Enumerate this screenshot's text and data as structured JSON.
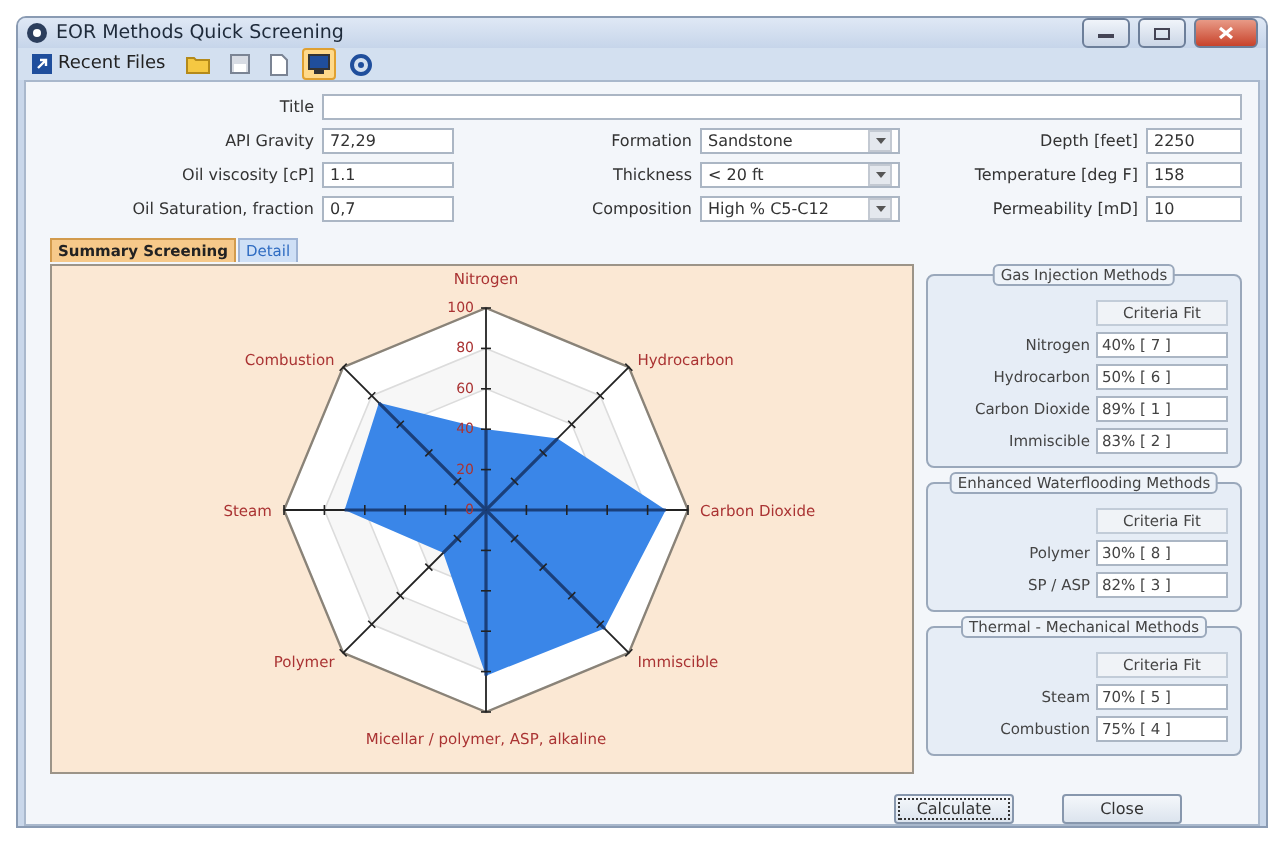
{
  "window": {
    "title": "EOR Methods Quick Screening"
  },
  "toolbar": [
    {
      "kind": "recent",
      "label": "Recent Files",
      "selected": false
    },
    {
      "kind": "folder",
      "selected": false
    },
    {
      "kind": "save",
      "selected": false
    },
    {
      "kind": "document",
      "selected": false
    },
    {
      "kind": "monitor",
      "selected": true
    },
    {
      "kind": "circle",
      "selected": false
    }
  ],
  "form": {
    "title_label": "Title",
    "rows": [
      [
        {
          "label": "API Gravity",
          "value": "72,29",
          "kind": "text"
        },
        {
          "label": "Formation",
          "value": "Sandstone",
          "kind": "select"
        },
        {
          "label": "Depth [feet]",
          "value": "2250",
          "kind": "text"
        }
      ],
      [
        {
          "label": "Oil viscosity [cP]",
          "value": "1.1",
          "kind": "text"
        },
        {
          "label": "Thickness",
          "value": "< 20 ft",
          "kind": "select"
        },
        {
          "label": "Temperature [deg F]",
          "value": "158",
          "kind": "text"
        }
      ],
      [
        {
          "label": "Oil Saturation, fraction",
          "value": "0,7",
          "kind": "text"
        },
        {
          "label": "Composition",
          "value": "High % C5-C12",
          "kind": "select"
        },
        {
          "label": "Permeability [mD]",
          "value": "10",
          "kind": "text"
        }
      ]
    ]
  },
  "tabs": [
    {
      "label": "Summary Screening",
      "selected": true
    },
    {
      "label": "Detail",
      "selected": false
    }
  ],
  "radar": {
    "scale": [
      "100",
      "80",
      "60",
      "40",
      "20",
      "0"
    ],
    "axes": [
      {
        "label": "Nitrogen",
        "level": 0.4
      },
      {
        "label": "Hydrocarbon",
        "level": 0.5
      },
      {
        "label": "Carbon Dioxide",
        "level": 0.89
      },
      {
        "label": "Immiscible",
        "level": 0.83
      },
      {
        "label": "Micellar / polymer, ASP, alkaline",
        "level": 0.82
      },
      {
        "label": "Polymer",
        "level": 0.3
      },
      {
        "label": "Steam",
        "level": 0.7
      },
      {
        "label": "Combustion",
        "level": 0.75
      }
    ]
  },
  "groups": [
    {
      "title": "Gas Injection Methods",
      "header": "Criteria Fit",
      "rows": [
        {
          "label": "Nitrogen",
          "value": "40% [ 7 ]"
        },
        {
          "label": "Hydrocarbon",
          "value": "50% [ 6 ]"
        },
        {
          "label": "Carbon Dioxide",
          "value": "89% [ 1 ]"
        },
        {
          "label": "Immiscible",
          "value": "83% [ 2 ]"
        }
      ]
    },
    {
      "title": "Enhanced Waterflooding Methods",
      "header": "Criteria Fit",
      "rows": [
        {
          "label": "Polymer",
          "value": "30% [ 8 ]"
        },
        {
          "label": "SP / ASP",
          "value": "82% [ 3 ]"
        }
      ]
    },
    {
      "title": "Thermal - Mechanical Methods",
      "header": "Criteria Fit",
      "rows": [
        {
          "label": "Steam",
          "value": "70% [ 5 ]"
        },
        {
          "label": "Combustion",
          "value": "75% [ 4 ]"
        }
      ]
    }
  ],
  "buttons": [
    {
      "label": "Calculate",
      "selected": true
    },
    {
      "label": "Close",
      "selected": false
    }
  ]
}
